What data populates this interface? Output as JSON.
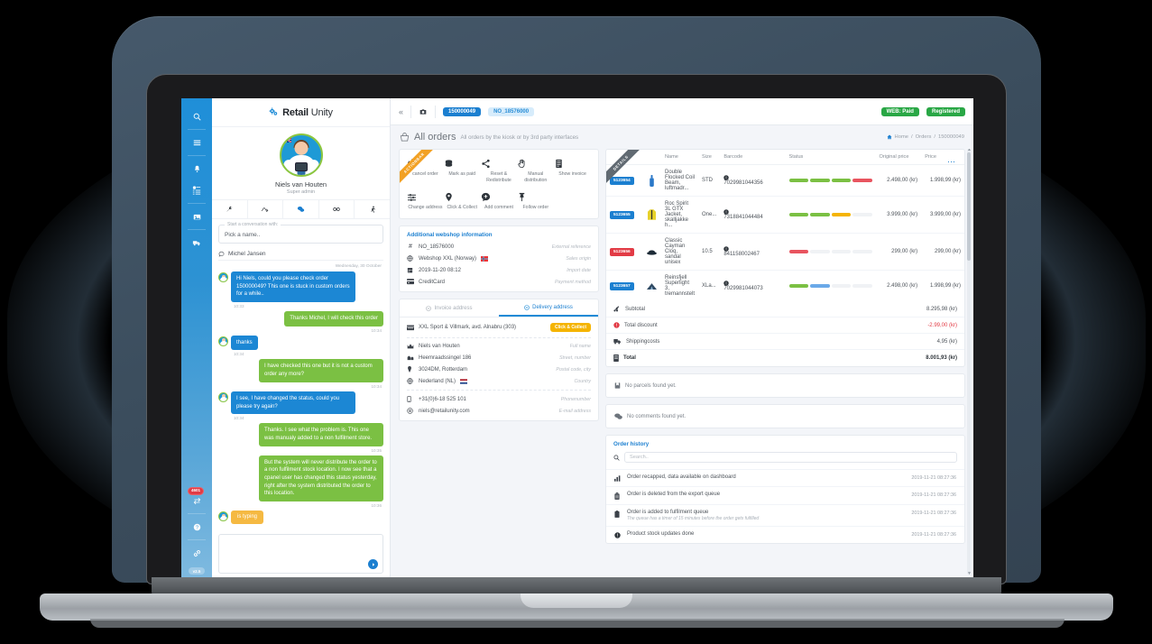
{
  "brand": {
    "name_bold": "Retail",
    "name_light": "Unity",
    "logo_icon": "gears-icon"
  },
  "rail": {
    "items": [
      {
        "icon": "search-icon",
        "name": "search"
      },
      {
        "icon": "menu-icon",
        "name": "menu"
      },
      {
        "icon": "bell-icon",
        "name": "notifications"
      },
      {
        "icon": "tasks-icon",
        "name": "tasks"
      },
      {
        "icon": "image-icon",
        "name": "media"
      },
      {
        "icon": "truck-icon",
        "name": "shipping"
      }
    ],
    "bottom": [
      {
        "icon": "exchange-icon",
        "name": "queue",
        "badge": "4601"
      },
      {
        "icon": "help-icon",
        "name": "help"
      },
      {
        "icon": "link-icon",
        "name": "connections"
      }
    ],
    "version": "v2.5"
  },
  "profile": {
    "name": "Niels van Houten",
    "role": "Super admin",
    "flag": "uk-flag-icon",
    "tabs": [
      {
        "icon": "wrench-icon",
        "name": "tools",
        "active": false
      },
      {
        "icon": "activity-icon",
        "name": "activity",
        "active": false
      },
      {
        "icon": "chat-icon",
        "name": "chat",
        "active": true
      },
      {
        "icon": "glasses-icon",
        "name": "watch",
        "active": false
      },
      {
        "icon": "runner-icon",
        "name": "running",
        "active": false
      }
    ]
  },
  "conversation_picker": {
    "legend": "Start a conversation with:",
    "value": "Pick a name.."
  },
  "chat": {
    "contact": "Michel Jansen",
    "date_divider": "Wednesday, 30 October",
    "messages": [
      {
        "side": "in",
        "text": "Hi Niels, could you please check order 150000049? This one is stuck in custom orders for a while..",
        "time": "10:33"
      },
      {
        "side": "out",
        "text": "Thanks Michel, I will check this order",
        "time": "10:34"
      },
      {
        "side": "in",
        "text": "thanks",
        "time": "10:34"
      },
      {
        "side": "out",
        "text": "I have checked this one but it is not a custom order any more?",
        "time": "10:34"
      },
      {
        "side": "in",
        "text": "I see, I have changed the status, could you please try again?",
        "time": "10:34"
      },
      {
        "side": "out",
        "text": "Thanks. I see what the problem is. This one was manualy added to a non fulfilment store.",
        "time": "10:35"
      },
      {
        "side": "out",
        "text": "But the system will never distribute the order to a non fulfilment stock location. I now see that a cpanel user has changed this status yesterday, right after the system distributed the order to this location.",
        "time": "10:36"
      }
    ],
    "typing_label": "is typing",
    "send_icon": "send-icon"
  },
  "topbar": {
    "collapse_icon": "chevron-double-left-icon",
    "camera_icon": "camera-icon",
    "order_id": "150000049",
    "external_ref": "NO_18576000",
    "status_badges": [
      {
        "label": "WEB: Paid",
        "color": "#29a745"
      },
      {
        "label": "Registered",
        "color": "#29a745"
      }
    ]
  },
  "page": {
    "icon": "basket-icon",
    "title": "All orders",
    "subtitle": "All orders by the kiosk or by 3rd party interfaces",
    "breadcrumb": [
      "Home",
      "Orders",
      "150000049"
    ]
  },
  "actionbar": {
    "ribbon": "ACTIONBAR",
    "actions": [
      {
        "icon": "power-icon",
        "label": "cancel order"
      },
      {
        "icon": "coins-icon",
        "label": "Mark as paid"
      },
      {
        "icon": "share-icon",
        "label": "Reset & Redistribute"
      },
      {
        "icon": "hand-icon",
        "label": "Manual distribution"
      },
      {
        "icon": "invoice-icon",
        "label": "Show invoice"
      },
      {
        "icon": "sliders-icon",
        "label": "Change address"
      },
      {
        "icon": "pin-location-icon",
        "label": "Click & Collect"
      },
      {
        "icon": "comment-plus-icon",
        "label": "Add comment"
      },
      {
        "icon": "thumbtack-icon",
        "label": "Follow order"
      }
    ]
  },
  "webshop_info": {
    "heading": "Additional webshop information",
    "rows": [
      {
        "icon": "hash-icon",
        "value": "NO_18576000",
        "label": "External reference",
        "flag": ""
      },
      {
        "icon": "globe-icon",
        "value": "Webshop XXL (Norway)",
        "label": "Sales origin",
        "flag": "norway-flag-icon"
      },
      {
        "icon": "calendar-icon",
        "value": "2019-11-20 08:12",
        "label": "Import date",
        "flag": ""
      },
      {
        "icon": "creditcard-icon",
        "value": "CreditCard",
        "label": "Payment method",
        "flag": ""
      }
    ]
  },
  "address": {
    "tabs": [
      {
        "icon": "invoice-circle-icon",
        "label": "Invoice address",
        "active": false
      },
      {
        "icon": "delivery-circle-icon",
        "label": "Delivery address",
        "active": true
      }
    ],
    "store": {
      "icon": "store-icon",
      "name": "XXL Sport & Villmark, avd. Alnabru (303)",
      "badge": "Click & Collect"
    },
    "rows": [
      {
        "icon": "crown-icon",
        "value": "Niels van Houten",
        "label": "Full name",
        "flag": ""
      },
      {
        "icon": "street-icon",
        "value": "Heemraadssingel 186",
        "label": "Street, number",
        "flag": ""
      },
      {
        "icon": "pin-icon",
        "value": "3024DM, Rotterdam",
        "label": "Postal code, city",
        "flag": ""
      },
      {
        "icon": "globe-icon",
        "value": "Nederland (NL)",
        "label": "Country",
        "flag": "netherlands-flag-icon"
      },
      {
        "icon": "phone-icon",
        "value": "+31(0)6-18 525 101",
        "label": "Phonenumber",
        "flag": ""
      },
      {
        "icon": "at-icon",
        "value": "niels@retailunity.com",
        "label": "E-mail address",
        "flag": ""
      }
    ]
  },
  "details": {
    "ribbon": "DETAILS",
    "more_icon": "ellipsis-icon",
    "columns": [
      "",
      "",
      "Name",
      "Size",
      "Barcode",
      "Status",
      "Original price",
      "Price"
    ],
    "rows": [
      {
        "id": "5123654",
        "id_color": "blue",
        "thumb": "bottle-icon",
        "name": "Double Flocked Coil Beam, luftmadr...",
        "size": "STD",
        "barcode": "7029981044356",
        "bars": [
          "#7bc043",
          "#7bc043",
          "#7bc043",
          "#e8545f"
        ],
        "original_price": "2.498,00 (kr)",
        "price": "1.998,99 (kr)"
      },
      {
        "id": "5123655",
        "id_color": "blue",
        "thumb": "jacket-icon",
        "name": "Roc Spirit 3L GTX Jacket, skalljakke h...",
        "size": "One...",
        "barcode": "7318841044484",
        "bars": [
          "#7bc043",
          "#7bc043",
          "#f5b400",
          "#f0f2f5"
        ],
        "original_price": "3.999,00 (kr)",
        "price": "3.999,00 (kr)"
      },
      {
        "id": "5123656",
        "id_color": "red",
        "thumb": "sandal-icon",
        "name": "Classic Cayman Cloq, sandal unisex",
        "size": "10.5",
        "barcode": "841158002467",
        "bars": [
          "#e8545f",
          "#f0f2f5",
          "#f0f2f5",
          "#f0f2f5"
        ],
        "original_price": "299,00 (kr)",
        "price": "299,00 (kr)"
      },
      {
        "id": "5123657",
        "id_color": "blue",
        "thumb": "tent-icon",
        "name": "Reinsfjell Superlight 3, tremannstelt",
        "size": "XLa...",
        "barcode": "7029981044073",
        "bars": [
          "#7bc043",
          "#6aa9e8",
          "#f0f2f5",
          "#f0f2f5"
        ],
        "original_price": "2.498,00 (kr)",
        "price": "1.998,99 (kr)"
      }
    ],
    "totals": [
      {
        "icon": "scissors-icon",
        "label": "Subtotal",
        "value": "8.295,98 (kr)",
        "negative": false,
        "bold": false
      },
      {
        "icon": "discount-icon",
        "label": "Total discount",
        "value": "-2.99,00 (kr)",
        "negative": true,
        "bold": false
      },
      {
        "icon": "truck-icon",
        "label": "Shippingcosts",
        "value": "4,95 (kr)",
        "negative": false,
        "bold": false
      },
      {
        "icon": "receipt-icon",
        "label": "Total",
        "value": "8.001,93 (kr)",
        "negative": false,
        "bold": true
      }
    ]
  },
  "parcels": {
    "icon": "parcel-icon",
    "empty_text": "No parcels found yet."
  },
  "comments": {
    "icon": "comments-icon",
    "empty_text": "No comments found yet."
  },
  "order_history": {
    "heading": "Order history",
    "search_icon": "search-icon",
    "search_placeholder": "Search..",
    "entries": [
      {
        "icon": "chart-icon",
        "text": "Order recapped, data available on dashboard",
        "sub": "",
        "date": "2019-11-21 08:27:36"
      },
      {
        "icon": "trash-icon",
        "text": "Order is deleted from the export queue",
        "sub": "",
        "date": "2019-11-21 08:27:36"
      },
      {
        "icon": "box-icon",
        "text": "Order is added to fulfilment queue",
        "sub": "The queue has a timer of 15 minutes before the order gets fulfilled",
        "date": "2019-11-21 08:27:36"
      },
      {
        "icon": "circle-icon",
        "text": "Product stock updates done",
        "sub": "",
        "date": "2019-11-21 08:27:36"
      }
    ]
  }
}
